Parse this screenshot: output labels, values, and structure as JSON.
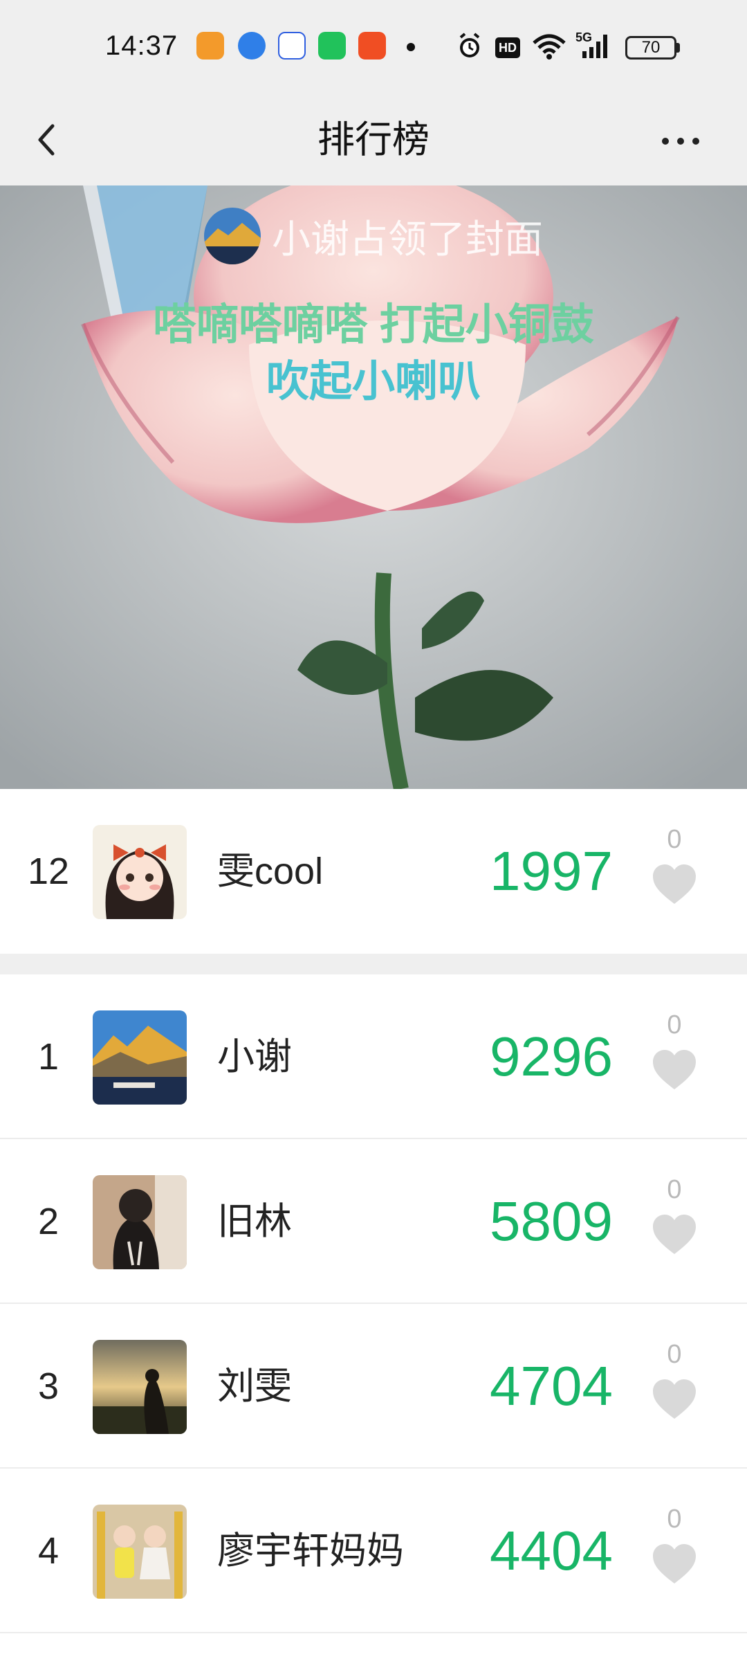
{
  "status_bar": {
    "time": "14:37",
    "hd_label": "HD",
    "network": "5G",
    "battery": "70"
  },
  "nav": {
    "title": "排行榜",
    "back_icon": "chevron-left-icon",
    "more_icon": "more-dots-icon"
  },
  "cover": {
    "owner_text": "小谢占领了封面",
    "lyric_line1": "嗒嘀嗒嘀嗒 打起小铜鼓",
    "lyric_line2": "吹起小喇叭"
  },
  "my_rank": {
    "rank": "12",
    "name": "雯cool",
    "score": "1997",
    "likes": "0"
  },
  "leaderboard": [
    {
      "rank": "1",
      "name": "小谢",
      "score": "9296",
      "likes": "0"
    },
    {
      "rank": "2",
      "name": "旧林",
      "score": "5809",
      "likes": "0"
    },
    {
      "rank": "3",
      "name": "刘雯",
      "score": "4704",
      "likes": "0"
    },
    {
      "rank": "4",
      "name": "廖宇轩妈妈",
      "score": "4404",
      "likes": "0"
    }
  ],
  "colors": {
    "score": "#18b567",
    "bar_bg": "#efefef",
    "heart": "#d9d9d9"
  }
}
